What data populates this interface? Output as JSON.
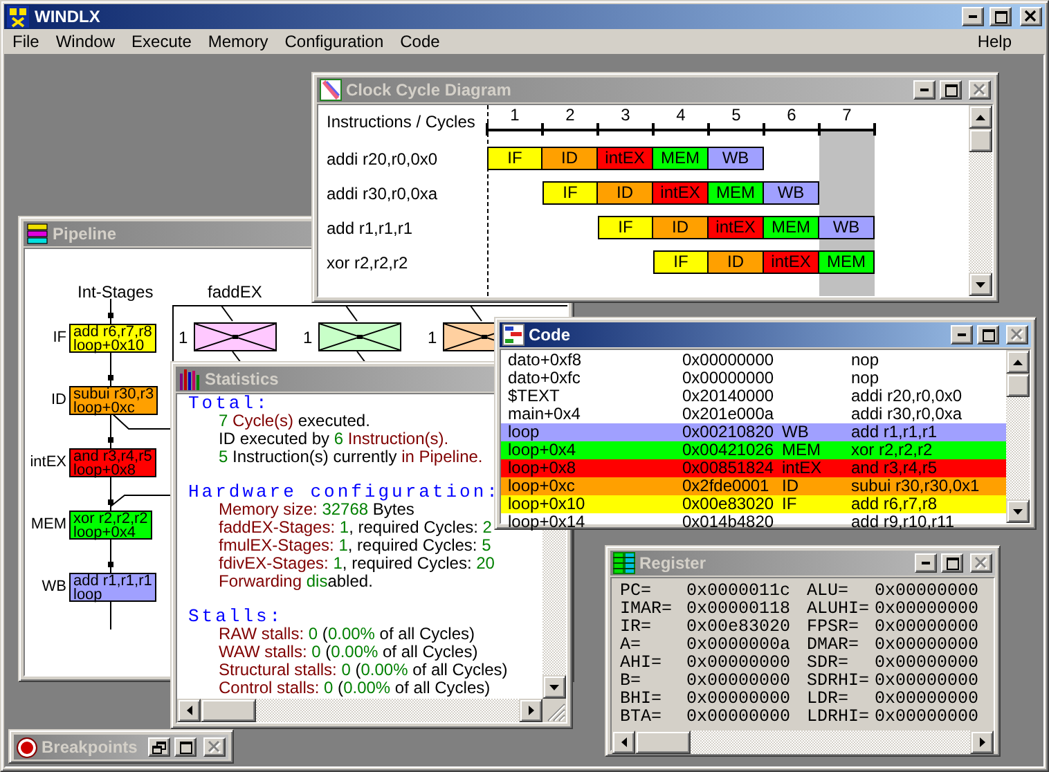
{
  "window": {
    "title": "WINDLX",
    "close_disabled": false
  },
  "menu": [
    {
      "label": "File"
    },
    {
      "label": "Window"
    },
    {
      "label": "Execute"
    },
    {
      "label": "Memory"
    },
    {
      "label": "Configuration"
    },
    {
      "label": "Code"
    }
  ],
  "help_menu": "Help",
  "pipeline": {
    "title": "Pipeline",
    "active": false,
    "int_label": "Int-Stages",
    "stages": [
      {
        "label": "IF",
        "instruction": "add r6,r7,r8",
        "address": "loop+0x10",
        "color": "#ffff00"
      },
      {
        "label": "ID",
        "instruction": "subui r30,r3",
        "address": "loop+0xc",
        "color": "#ffa000"
      },
      {
        "label": "intEX",
        "instruction": "and r3,r4,r5",
        "address": "loop+0x8",
        "color": "#ff0000"
      },
      {
        "label": "MEM",
        "instruction": "xor r2,r2,r2",
        "address": "loop+0x4",
        "color": "#00ff00"
      },
      {
        "label": "WB",
        "instruction": "add r1,r1,r1",
        "address": "loop",
        "color": "#a0a0ff"
      }
    ],
    "unit_label": "faddEX",
    "units": [
      {
        "count": "1",
        "color": "#ffc8ff"
      },
      {
        "count": "1",
        "color": "#c8ffc8"
      },
      {
        "count": "1",
        "color": "#ffd0a0"
      }
    ]
  },
  "clock_cycle_diagram": {
    "title": "Clock Cycle Diagram",
    "active": false,
    "close_disabled": true,
    "header": "Instructions / Cycles",
    "cycles": [
      {
        "label": "1",
        "selected": false
      },
      {
        "label": "2",
        "selected": false
      },
      {
        "label": "3",
        "selected": false
      },
      {
        "label": "4",
        "selected": false
      },
      {
        "label": "5",
        "selected": false
      },
      {
        "label": "6",
        "selected": false
      },
      {
        "label": "7",
        "selected": true
      }
    ],
    "rows": [
      {
        "instruction": "addi r20,r0,0x0",
        "cells": [
          {
            "kind": "stage",
            "label": "IF",
            "color": "#ffff00"
          },
          {
            "kind": "stage",
            "label": "ID",
            "color": "#ffa000"
          },
          {
            "kind": "stage",
            "label": "intEX",
            "color": "#ff0000"
          },
          {
            "kind": "stage",
            "label": "MEM",
            "color": "#00ff00"
          },
          {
            "kind": "stage",
            "label": "WB",
            "color": "#a0a0ff"
          },
          {
            "kind": "empty"
          },
          {
            "kind": "empty"
          }
        ]
      },
      {
        "instruction": "addi r30,r0,0xa",
        "cells": [
          {
            "kind": "empty"
          },
          {
            "kind": "stage",
            "label": "IF",
            "color": "#ffff00"
          },
          {
            "kind": "stage",
            "label": "ID",
            "color": "#ffa000"
          },
          {
            "kind": "stage",
            "label": "intEX",
            "color": "#ff0000"
          },
          {
            "kind": "stage",
            "label": "MEM",
            "color": "#00ff00"
          },
          {
            "kind": "stage",
            "label": "WB",
            "color": "#a0a0ff"
          },
          {
            "kind": "empty"
          }
        ]
      },
      {
        "instruction": "add r1,r1,r1",
        "cells": [
          {
            "kind": "empty"
          },
          {
            "kind": "empty"
          },
          {
            "kind": "stage",
            "label": "IF",
            "color": "#ffff00"
          },
          {
            "kind": "stage",
            "label": "ID",
            "color": "#ffa000"
          },
          {
            "kind": "stage",
            "label": "intEX",
            "color": "#ff0000"
          },
          {
            "kind": "stage",
            "label": "MEM",
            "color": "#00ff00"
          },
          {
            "kind": "stage",
            "label": "WB",
            "color": "#a0a0ff"
          }
        ]
      },
      {
        "instruction": "xor r2,r2,r2",
        "cells": [
          {
            "kind": "empty"
          },
          {
            "kind": "empty"
          },
          {
            "kind": "empty"
          },
          {
            "kind": "stage",
            "label": "IF",
            "color": "#ffff00"
          },
          {
            "kind": "stage",
            "label": "ID",
            "color": "#ffa000"
          },
          {
            "kind": "stage",
            "label": "intEX",
            "color": "#ff0000"
          },
          {
            "kind": "stage",
            "label": "MEM",
            "color": "#00ff00"
          }
        ]
      }
    ]
  },
  "statistics": {
    "title": "Statistics",
    "active": false,
    "sections": [
      {
        "heading": "Total:",
        "lines": [
          [
            {
              "kind": "value",
              "text": "7"
            },
            {
              "kind": "label",
              "text": " Cycle(s)"
            },
            {
              "kind": "plain",
              "text": " executed."
            }
          ],
          [
            {
              "kind": "plain",
              "text": "ID executed by "
            },
            {
              "kind": "value",
              "text": "6"
            },
            {
              "kind": "label",
              "text": " Instruction(s)."
            }
          ],
          [
            {
              "kind": "value",
              "text": "5"
            },
            {
              "kind": "plain",
              "text": " Instruction(s) currently "
            },
            {
              "kind": "label",
              "text": "in Pipeline."
            }
          ]
        ]
      },
      {
        "heading": "Hardware configuration:",
        "lines": [
          [
            {
              "kind": "label",
              "text": "Memory size: "
            },
            {
              "kind": "value",
              "text": "32768"
            },
            {
              "kind": "plain",
              "text": " Bytes"
            }
          ],
          [
            {
              "kind": "label",
              "text": "faddEX-Stages: "
            },
            {
              "kind": "value",
              "text": "1"
            },
            {
              "kind": "plain",
              "text": ", required Cycles: "
            },
            {
              "kind": "value",
              "text": "2"
            }
          ],
          [
            {
              "kind": "label",
              "text": "fmulEX-Stages: "
            },
            {
              "kind": "value",
              "text": "1"
            },
            {
              "kind": "plain",
              "text": ", required Cycles: "
            },
            {
              "kind": "value",
              "text": "5"
            }
          ],
          [
            {
              "kind": "label",
              "text": "fdivEX-Stages: "
            },
            {
              "kind": "value",
              "text": "1"
            },
            {
              "kind": "plain",
              "text": ", required Cycles: "
            },
            {
              "kind": "value",
              "text": "20"
            }
          ],
          [
            {
              "kind": "label",
              "text": "Forwarding "
            },
            {
              "kind": "value",
              "text": "dis"
            },
            {
              "kind": "plain",
              "text": "abled."
            }
          ]
        ]
      },
      {
        "heading": "Stalls:",
        "lines": [
          [
            {
              "kind": "label",
              "text": "RAW stalls: "
            },
            {
              "kind": "value",
              "text": "0"
            },
            {
              "kind": "plain",
              "text": " ("
            },
            {
              "kind": "value",
              "text": "0.00%"
            },
            {
              "kind": "plain",
              "text": " of all Cycles)"
            }
          ],
          [
            {
              "kind": "label",
              "text": "WAW stalls: "
            },
            {
              "kind": "value",
              "text": "0"
            },
            {
              "kind": "plain",
              "text": " ("
            },
            {
              "kind": "value",
              "text": "0.00%"
            },
            {
              "kind": "plain",
              "text": " of all Cycles)"
            }
          ],
          [
            {
              "kind": "label",
              "text": "Structural stalls: "
            },
            {
              "kind": "value",
              "text": "0"
            },
            {
              "kind": "plain",
              "text": " ("
            },
            {
              "kind": "value",
              "text": "0.00%"
            },
            {
              "kind": "plain",
              "text": " of all Cycles)"
            }
          ],
          [
            {
              "kind": "label",
              "text": "Control stalls: "
            },
            {
              "kind": "value",
              "text": "0"
            },
            {
              "kind": "plain",
              "text": " ("
            },
            {
              "kind": "value",
              "text": "0.00%"
            },
            {
              "kind": "plain",
              "text": " of all Cycles)"
            }
          ]
        ]
      }
    ]
  },
  "code": {
    "title": "Code",
    "active": true,
    "close_disabled": true,
    "rows": [
      {
        "label": "dato+0xf8",
        "address": "0x00000000",
        "instruction": "nop"
      },
      {
        "label": "dato+0xfc",
        "address": "0x00000000",
        "instruction": "nop"
      },
      {
        "label": "$TEXT",
        "address": "0x20140000",
        "instruction": "addi r20,r0,0x0"
      },
      {
        "label": "main+0x4",
        "address": "0x201e000a",
        "instruction": "addi r30,r0,0xa"
      },
      {
        "label": "loop",
        "address": "0x00210820",
        "stage": "WB",
        "instruction": "add r1,r1,r1",
        "color": "#a0a0ff"
      },
      {
        "label": "loop+0x4",
        "address": "0x00421026",
        "stage": "MEM",
        "instruction": "xor r2,r2,r2",
        "color": "#00ff00"
      },
      {
        "label": "loop+0x8",
        "address": "0x00851824",
        "stage": "intEX",
        "instruction": "and r3,r4,r5",
        "color": "#ff0000"
      },
      {
        "label": "loop+0xc",
        "address": "0x2fde0001",
        "stage": "ID",
        "instruction": "subui r30,r30,0x1",
        "color": "#ffa000"
      },
      {
        "label": "loop+0x10",
        "address": "0x00e83020",
        "stage": "IF",
        "instruction": "add r6,r7,r8",
        "color": "#ffff00"
      },
      {
        "label": "loop+0x14",
        "address": "0x014b4820",
        "instruction": "add r9,r10,r11"
      }
    ]
  },
  "register": {
    "title": "Register",
    "active": false,
    "close_disabled": true,
    "rows": [
      [
        "PC=",
        "0x0000011c",
        "ALU=",
        "0x00000000"
      ],
      [
        "IMAR=",
        "0x00000118",
        "ALUHI=",
        "0x00000000"
      ],
      [
        "IR=",
        "0x00e83020",
        "FPSR=",
        "0x00000000"
      ],
      [
        "A=",
        "0x0000000a",
        "DMAR=",
        "0x00000000"
      ],
      [
        "AHI=",
        "0x00000000",
        "SDR=",
        "0x00000000"
      ],
      [
        "B=",
        "0x00000000",
        "SDRHI=",
        "0x00000000"
      ],
      [
        "BHI=",
        "0x00000000",
        "LDR=",
        "0x00000000"
      ],
      [
        "BTA=",
        "0x00000000",
        "LDRHI=",
        "0x00000000"
      ]
    ]
  },
  "breakpoints": {
    "title": "Breakpoints",
    "active": false,
    "close_disabled": true
  }
}
